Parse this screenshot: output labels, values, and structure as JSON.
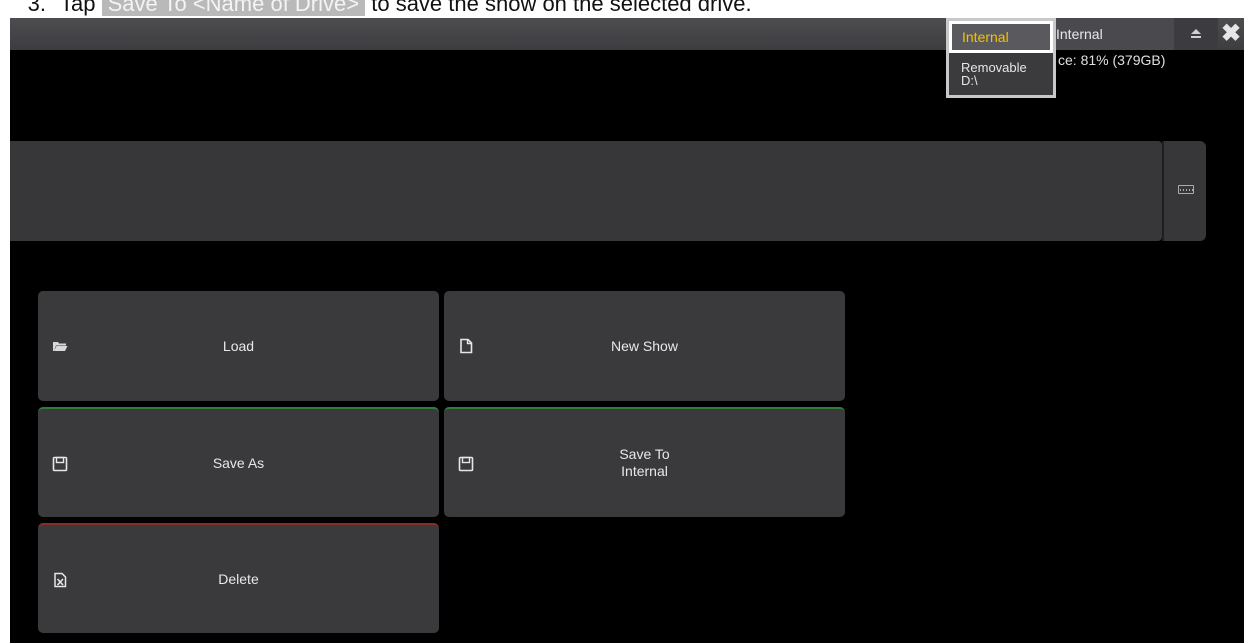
{
  "instruction": {
    "number": "3.",
    "text_before": "Tap",
    "highlight": "Save To <Name of Drive>",
    "text_after": "to save the show on the selected drive."
  },
  "titlebar": {
    "drive_selector": "Internal",
    "eject_icon": "eject-icon",
    "close_icon": "close-icon"
  },
  "space_info": "ce: 81% (379GB)",
  "drive_popup": {
    "options": [
      {
        "label": "Internal",
        "selected": true
      },
      {
        "label_line1": "Removable",
        "label_line2": "D:\\"
      }
    ]
  },
  "name_input": {
    "value": "",
    "keyboard_icon": "keyboard-icon"
  },
  "buttons": {
    "load": {
      "label": "Load",
      "icon": "folder-open-icon"
    },
    "new_show": {
      "label": "New Show",
      "icon": "new-file-icon"
    },
    "save_as": {
      "label": "Save As",
      "icon": "floppy-disk-icon"
    },
    "save_to_line1": "Save To",
    "save_to_line2": "Internal",
    "save_to_icon": "floppy-disk-icon",
    "delete": {
      "label": "Delete",
      "icon": "delete-file-icon"
    }
  },
  "colors": {
    "background": "#000000",
    "button": "#3a3a3d",
    "selected_option": "#f2c200",
    "save_accent": "#2e7d3a",
    "delete_accent": "#8a2a2a"
  }
}
